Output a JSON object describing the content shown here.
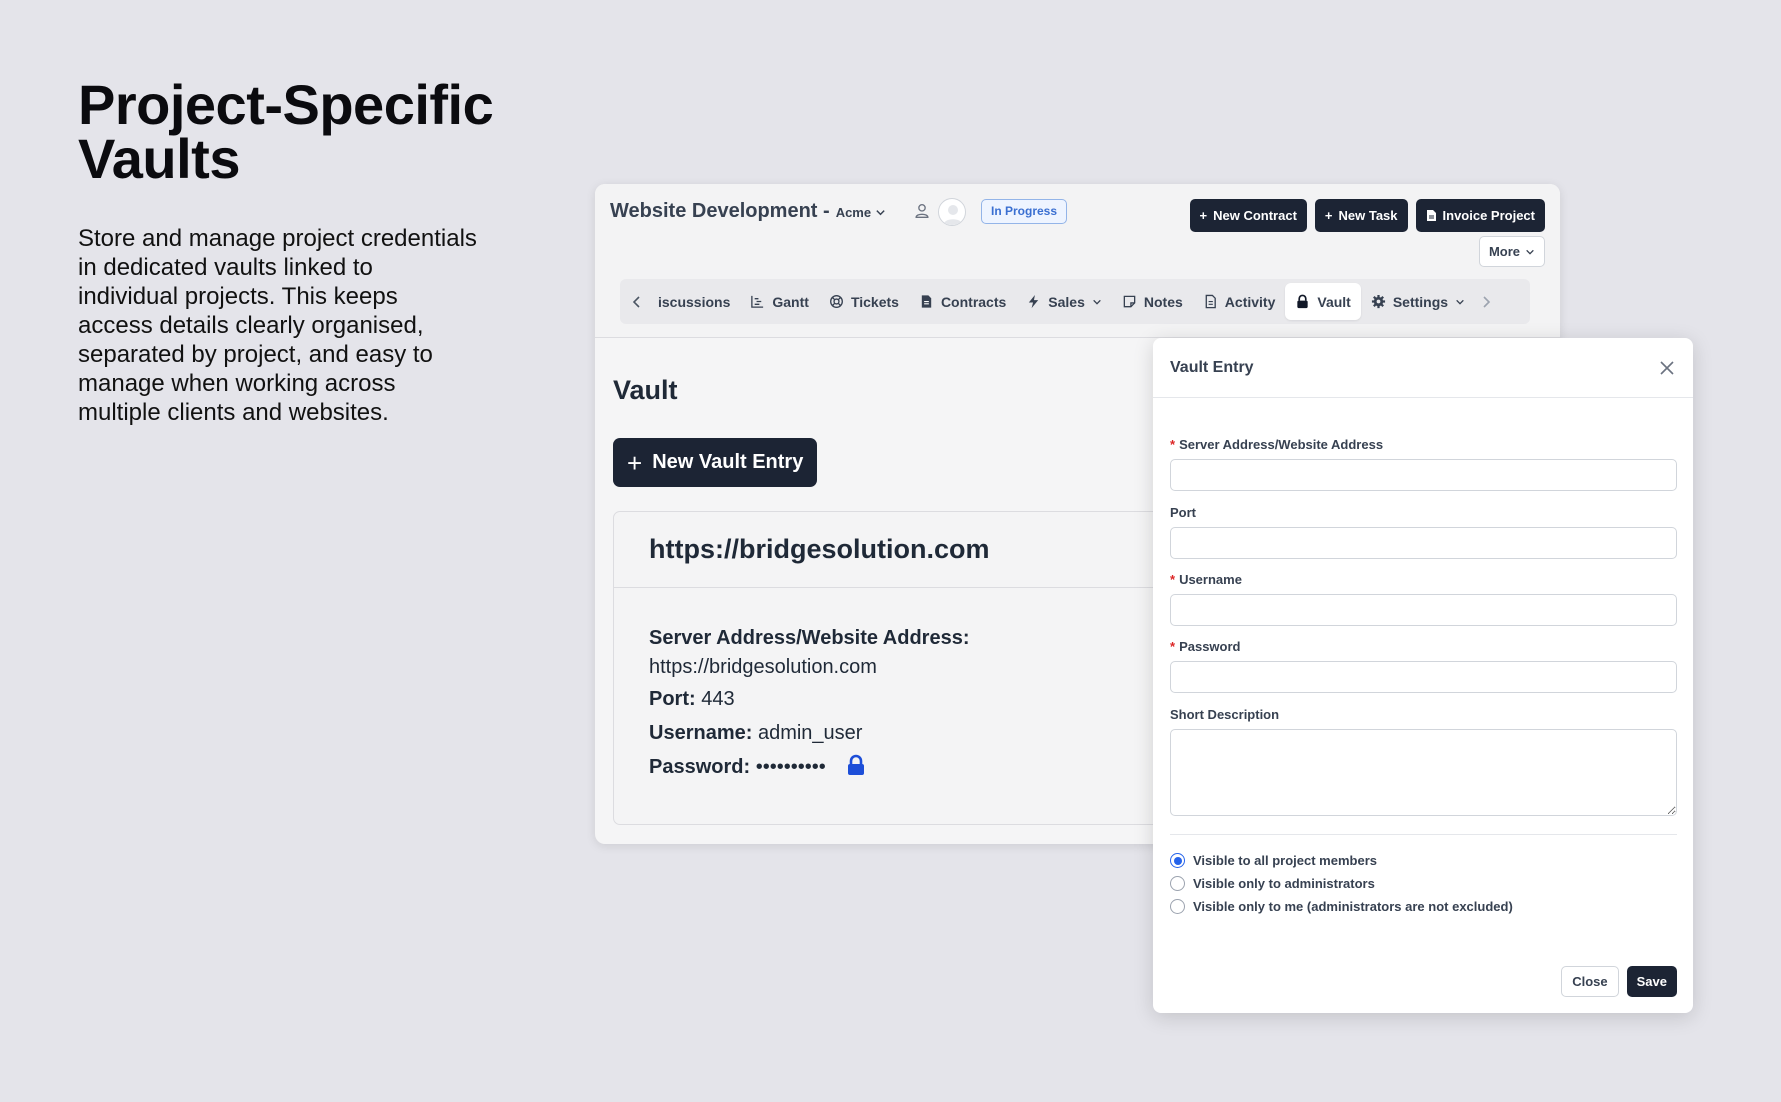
{
  "hero": {
    "title": "Project-Specific Vaults",
    "description": "Store and manage project credentials in dedicated vaults linked to individual projects. This keeps access details clearly organised, separated by project, and easy to manage when working across multiple clients and websites."
  },
  "project": {
    "title": "Website Development -",
    "client": "Acme",
    "status": "In Progress"
  },
  "actions": {
    "new_contract": "New Contract",
    "new_task": "New Task",
    "invoice_project": "Invoice Project",
    "more": "More"
  },
  "tabs": [
    {
      "label": "iscussions",
      "icon": "discussions-icon"
    },
    {
      "label": "Gantt",
      "icon": "gantt-icon"
    },
    {
      "label": "Tickets",
      "icon": "lifebuoy-icon"
    },
    {
      "label": "Contracts",
      "icon": "contract-icon"
    },
    {
      "label": "Sales",
      "icon": "bolt-icon"
    },
    {
      "label": "Notes",
      "icon": "note-icon"
    },
    {
      "label": "Activity",
      "icon": "document-icon"
    },
    {
      "label": "Vault",
      "icon": "lock-icon"
    },
    {
      "label": "Settings",
      "icon": "gear-icon"
    }
  ],
  "vault": {
    "heading": "Vault",
    "new_entry_button": "New Vault Entry",
    "entry": {
      "title": "https://bridgesolution.com",
      "address_label": "Server Address/Website Address:",
      "address_value": "https://bridgesolution.com",
      "port_label": "Port:",
      "port_value": "443",
      "username_label": "Username:",
      "username_value": "admin_user",
      "password_label": "Password:",
      "password_value": "••••••••••"
    }
  },
  "modal": {
    "title": "Vault Entry",
    "fields": {
      "server_label": "Server Address/Website Address",
      "port_label": "Port",
      "username_label": "Username",
      "password_label": "Password",
      "description_label": "Short Description"
    },
    "visibility": {
      "options": [
        "Visible to all project members",
        "Visible only to administrators",
        "Visible only to me (administrators are not excluded)"
      ],
      "selected_index": 0
    },
    "close_button": "Close",
    "save_button": "Save"
  },
  "colors": {
    "background": "#e4e4ea",
    "dark_button": "#1c2434",
    "accent_blue": "#2563eb",
    "required": "#dc2626"
  }
}
